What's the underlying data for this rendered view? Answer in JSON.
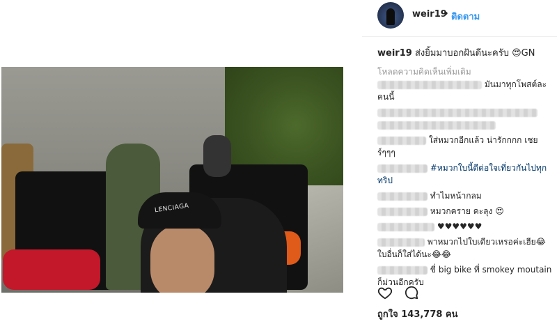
{
  "post": {
    "username": "weir19",
    "separator": "•",
    "follow_label": "ติดตาม",
    "caption_user": "weir19",
    "caption_text": "ส่งยิ้มมาบอกฝันดีนะครับ 😍GN",
    "load_more": "โหลดความคิดเห็นเพิ่มเติม",
    "likes": "ถูกใจ 143,778 คน",
    "cap_text": "LENCIAGA"
  },
  "comments": [
    {
      "text": "มันมาทุกโพสต์ละ คนนี้"
    },
    {
      "text": ""
    },
    {
      "text": "ใส่หมวกอีกแล้ว น่ารักกกก เชยร์ๆๆๆ"
    },
    {
      "text": "#หมวกใบนี้ดีต่อใจเที่ยวกันไปทุกทริป"
    },
    {
      "text": "ทำไมหน้ากลม"
    },
    {
      "text": "หมวกคราย คะลุง 😍"
    },
    {
      "text": "♥♥♥♥♥♥"
    },
    {
      "text": "พาหมวกไปใบเดียวเหรอค่ะเฮีย😂 ใบอื่นก็ใส่ได้นะ😂😂"
    },
    {
      "text": "ขี่ big bike ที่ smokey moutain ก็ม่วนอีกครับ"
    }
  ],
  "colors": {
    "link_blue": "#3897f0",
    "hashtag": "#003569",
    "muted": "#999999"
  }
}
